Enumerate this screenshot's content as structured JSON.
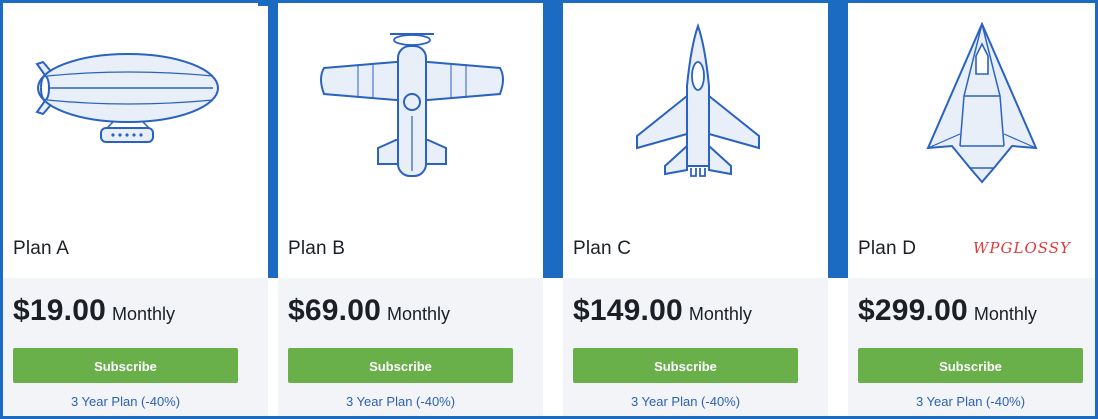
{
  "accent_color": "#1b6bc2",
  "button_color": "#69b04a",
  "plans": [
    {
      "name": "Plan A",
      "price": "$19.00",
      "period": "Monthly",
      "subscribe_label": "Subscribe",
      "three_year_label": "3 Year Plan (-40%)",
      "icon": "airship-icon"
    },
    {
      "name": "Plan B",
      "price": "$69.00",
      "period": "Monthly",
      "subscribe_label": "Subscribe",
      "three_year_label": "3 Year Plan (-40%)",
      "icon": "propeller-plane-icon"
    },
    {
      "name": "Plan C",
      "price": "$149.00",
      "period": "Monthly",
      "subscribe_label": "Subscribe",
      "three_year_label": "3 Year Plan (-40%)",
      "icon": "fighter-jet-icon"
    },
    {
      "name": "Plan D",
      "price": "$299.00",
      "period": "Monthly",
      "subscribe_label": "Subscribe",
      "three_year_label": "3 Year Plan (-40%)",
      "icon": "stealth-jet-icon"
    }
  ],
  "watermark": "WPGLOSSY"
}
